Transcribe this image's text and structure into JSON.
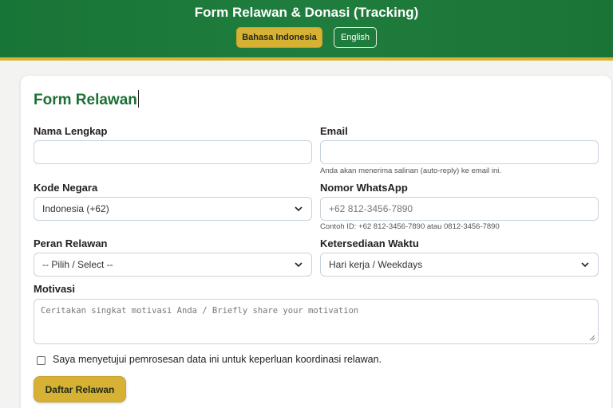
{
  "header": {
    "title": "Form Relawan & Donasi (Tracking)",
    "lang_id": "Bahasa Indonesia",
    "lang_en": "English"
  },
  "form": {
    "title": "Form Relawan",
    "name_label": "Nama Lengkap",
    "name_value": "",
    "email_label": "Email",
    "email_value": "",
    "email_help": "Anda akan menerima salinan (auto-reply) ke email ini.",
    "country_label": "Kode Negara",
    "country_selected": "Indonesia (+62)",
    "whatsapp_label": "Nomor WhatsApp",
    "whatsapp_placeholder": "+62 812-3456-7890",
    "whatsapp_help": "Contoh ID: +62 812-3456-7890 atau 0812-3456-7890",
    "role_label": "Peran Relawan",
    "role_selected": "-- Pilih / Select --",
    "availability_label": "Ketersediaan Waktu",
    "availability_selected": "Hari kerja / Weekdays",
    "motivation_label": "Motivasi",
    "motivation_placeholder": "Ceritakan singkat motivasi Anda / Briefly share your motivation",
    "consent_text": "Saya menyetujui pemrosesan data ini untuk keperluan koordinasi relawan.",
    "submit_label": "Daftar Relawan"
  },
  "colors": {
    "header_green": "#1e7a3c",
    "accent_gold": "#d7b134",
    "title_green": "#1d6f35"
  }
}
